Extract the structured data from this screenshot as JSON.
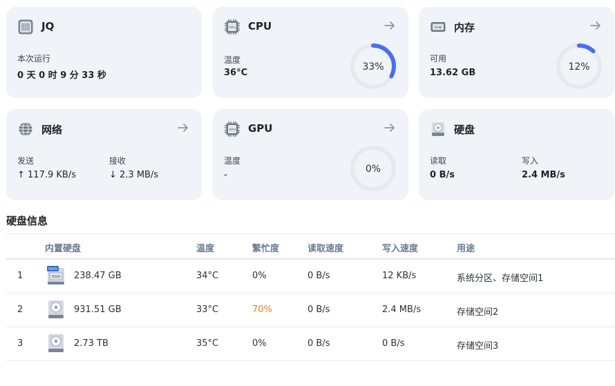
{
  "cards": {
    "system": {
      "title": "JQ",
      "label": "本次运行",
      "value": "0 天 0 时 9 分 33 秒"
    },
    "cpu": {
      "title": "CPU",
      "label": "温度",
      "value": "36°C",
      "usage": 33,
      "usage_text": "33%"
    },
    "memory": {
      "title": "内存",
      "label": "可用",
      "value": "13.62 GB",
      "usage": 12,
      "usage_text": "12%"
    },
    "network": {
      "title": "网络",
      "send_label": "发送",
      "send_value": "↑ 117.9 KB/s",
      "recv_label": "接收",
      "recv_value": "↓ 2.3 MB/s"
    },
    "gpu": {
      "title": "GPU",
      "label": "温度",
      "value": "-",
      "usage": 0,
      "usage_text": "0%"
    },
    "disk": {
      "title": "硬盘",
      "read_label": "读取",
      "read_value": "0 B/s",
      "write_label": "写入",
      "write_value": "2.4 MB/s"
    }
  },
  "disk_info": {
    "title": "硬盘信息",
    "columns": [
      "内置硬盘",
      "温度",
      "繁忙度",
      "读取速度",
      "写入速度",
      "用途"
    ],
    "rows": [
      {
        "index": "1",
        "type": "ssd",
        "ssd_badge": "fnOS",
        "ssd_text": "SSD",
        "capacity": "238.47 GB",
        "temp": "34°C",
        "busy": "0%",
        "read": "0 B/s",
        "write": "12 KB/s",
        "usage": "系统分区、存储空间1"
      },
      {
        "index": "2",
        "type": "hdd",
        "capacity": "931.51 GB",
        "temp": "33°C",
        "busy": "70%",
        "read": "0 B/s",
        "write": "2.4 MB/s",
        "usage": "存储空间2"
      },
      {
        "index": "3",
        "type": "hdd",
        "capacity": "2.73 TB",
        "temp": "35°C",
        "busy": "0%",
        "read": "0 B/s",
        "write": "0 B/s",
        "usage": "存储空间3"
      }
    ]
  },
  "colors": {
    "accent": "#4a6cf7",
    "ring_track": "#e6e9ef",
    "warn": "#e67e22",
    "arrow": "#8b97a8"
  }
}
